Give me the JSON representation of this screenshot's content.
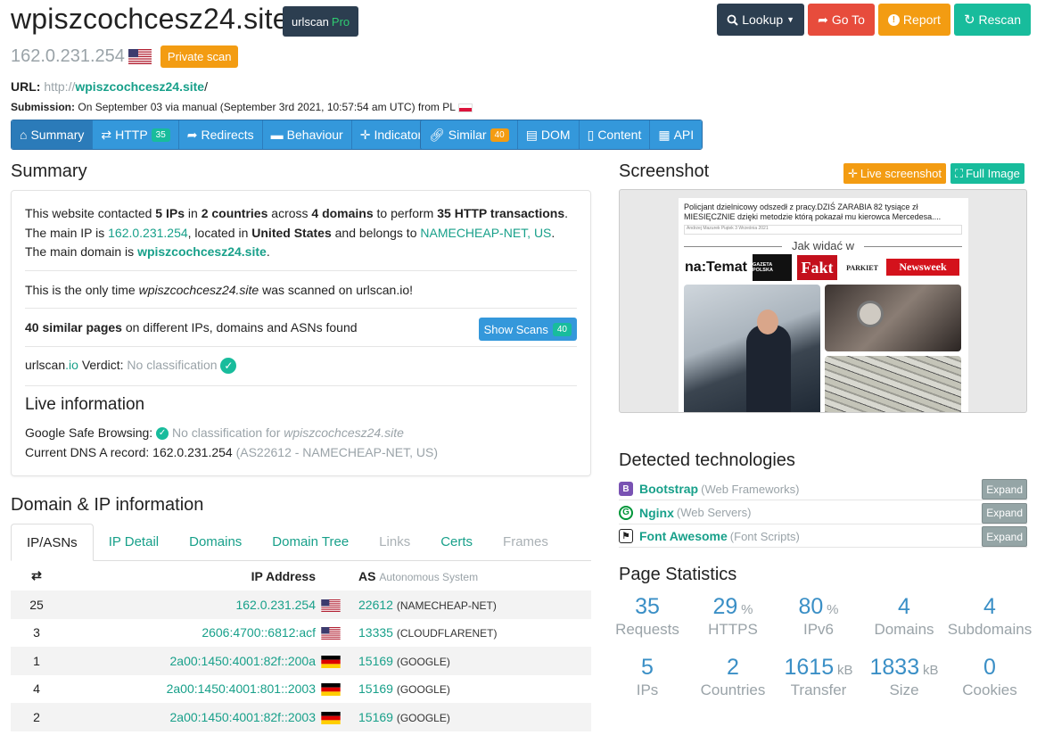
{
  "header": {
    "domain": "wpiszcochcesz24.site",
    "pro_badge": {
      "name": "urlscan",
      "suffix": "Pro"
    },
    "ip": "162.0.231.254",
    "private_badge": "Private scan",
    "buttons": {
      "lookup": "Lookup",
      "goto": "Go To",
      "report": "Report",
      "rescan": "Rescan"
    },
    "url_label": "URL:",
    "url_prefix": "http://",
    "url_domain": "wpiszcochcesz24.site",
    "url_suffix": "/",
    "submission_label": "Submission:",
    "submission_text": "On September 03 via manual (September 3rd 2021, 10:57:54 am UTC) from PL"
  },
  "nav": {
    "summary": "Summary",
    "http": "HTTP",
    "http_count": "35",
    "redirects": "Redirects",
    "behaviour": "Behaviour",
    "indicators": "Indicators",
    "similar": "Similar",
    "similar_count": "40",
    "dom": "DOM",
    "content": "Content",
    "api": "API"
  },
  "summary": {
    "title": "Summary",
    "l1_a": "This website contacted ",
    "ips": "5 IPs",
    "l1_b": " in ",
    "countries": "2 countries",
    "l1_c": " across ",
    "domains": "4 domains",
    "l1_d": " to perform ",
    "transactions": "35 HTTP transactions",
    "l1_e": ".",
    "l2_a": "The main IP is ",
    "main_ip": "162.0.231.254",
    "l2_b": ", located in ",
    "country": "United States",
    "l2_c": " and belongs to ",
    "asn_name": "NAMECHEAP-NET, US",
    "l2_d": ".",
    "l3_a": "The main domain is ",
    "main_domain": "wpiszcochcesz24.site",
    "l3_b": ".",
    "only_a": "This is the only time ",
    "only_domain": "wpiszcochcesz24.site",
    "only_b": " was scanned on urlscan.io!",
    "similar_bold": "40 similar pages",
    "similar_rest": " on different IPs, domains and ASNs found",
    "show_scans": "Show Scans",
    "show_scans_count": "40",
    "verdict_brand_a": "urlscan",
    "verdict_brand_b": ".io",
    "verdict_label": " Verdict: ",
    "verdict_value": "No classification",
    "live_title": "Live information",
    "gsb_label": "Google Safe Browsing: ",
    "gsb_value": "No classification for ",
    "gsb_domain": "wpiszcochcesz24.site",
    "dns_label": "Current DNS A record: ",
    "dns_value": "162.0.231.254",
    "dns_extra": "(AS22612 - NAMECHEAP-NET, US)"
  },
  "domain_ip": {
    "title": "Domain & IP information",
    "tabs": [
      "IP/ASNs",
      "IP Detail",
      "Domains",
      "Domain Tree",
      "Links",
      "Certs",
      "Frames"
    ],
    "col_ip": "IP Address",
    "col_as": "AS",
    "col_as_sub": "Autonomous System",
    "rows": [
      {
        "count": "25",
        "ip": "162.0.231.254",
        "flag": "us",
        "asn": "22612",
        "as_name": "(NAMECHEAP-NET)"
      },
      {
        "count": "3",
        "ip": "2606:4700::6812:acf",
        "flag": "us",
        "asn": "13335",
        "as_name": "(CLOUDFLARENET)"
      },
      {
        "count": "1",
        "ip": "2a00:1450:4001:82f::200a",
        "flag": "de",
        "asn": "15169",
        "as_name": "(GOOGLE)"
      },
      {
        "count": "4",
        "ip": "2a00:1450:4001:801::2003",
        "flag": "de",
        "asn": "15169",
        "as_name": "(GOOGLE)"
      },
      {
        "count": "2",
        "ip": "2a00:1450:4001:82f::2003",
        "flag": "de",
        "asn": "15169",
        "as_name": "(GOOGLE)"
      }
    ]
  },
  "screenshot": {
    "title": "Screenshot",
    "live_btn": "Live screenshot",
    "full_btn": "Full Image",
    "headline": "Policjant dzielnicowy odszedł z pracy.DZIŚ ZARABIA 82 tysiące zł MIESIĘCZNIE dzięki metodzie którą pokazał mu kierowca Mercedesa....",
    "meta": "Andrzej Mazurek   Piątek 3 Września 2021",
    "jak": "Jak widać w",
    "logos": [
      "na:Temat",
      "GAZETA POLSKA",
      "Fakt",
      "PARKIET",
      "Newsweek"
    ]
  },
  "tech": {
    "title": "Detected technologies",
    "expand": "Expand",
    "items": [
      {
        "name": "Bootstrap",
        "category": "(Web Frameworks)",
        "icon": "bootstrap-icon"
      },
      {
        "name": "Nginx",
        "category": "(Web Servers)",
        "icon": "nginx-icon"
      },
      {
        "name": "Font Awesome",
        "category": "(Font Scripts)",
        "icon": "font-awesome-icon"
      }
    ]
  },
  "stats": {
    "title": "Page Statistics",
    "items": [
      {
        "value": "35",
        "unit": "",
        "label": "Requests"
      },
      {
        "value": "29",
        "unit": "%",
        "label": "HTTPS"
      },
      {
        "value": "80",
        "unit": "%",
        "label": "IPv6"
      },
      {
        "value": "4",
        "unit": "",
        "label": "Domains"
      },
      {
        "value": "4",
        "unit": "",
        "label": "Subdomains"
      },
      {
        "value": "5",
        "unit": "",
        "label": "IPs"
      },
      {
        "value": "2",
        "unit": "",
        "label": "Countries"
      },
      {
        "value": "1615",
        "unit": "kB",
        "label": "Transfer"
      },
      {
        "value": "1833",
        "unit": "kB",
        "label": "Size"
      },
      {
        "value": "0",
        "unit": "",
        "label": "Cookies"
      }
    ]
  },
  "colors": {
    "teal": "#18bc9c",
    "link": "#18a08a",
    "blue": "#3498db",
    "orange": "#f39c12",
    "red": "#e74c3c",
    "dark": "#2c3e50",
    "stat": "#3a8fc6"
  }
}
